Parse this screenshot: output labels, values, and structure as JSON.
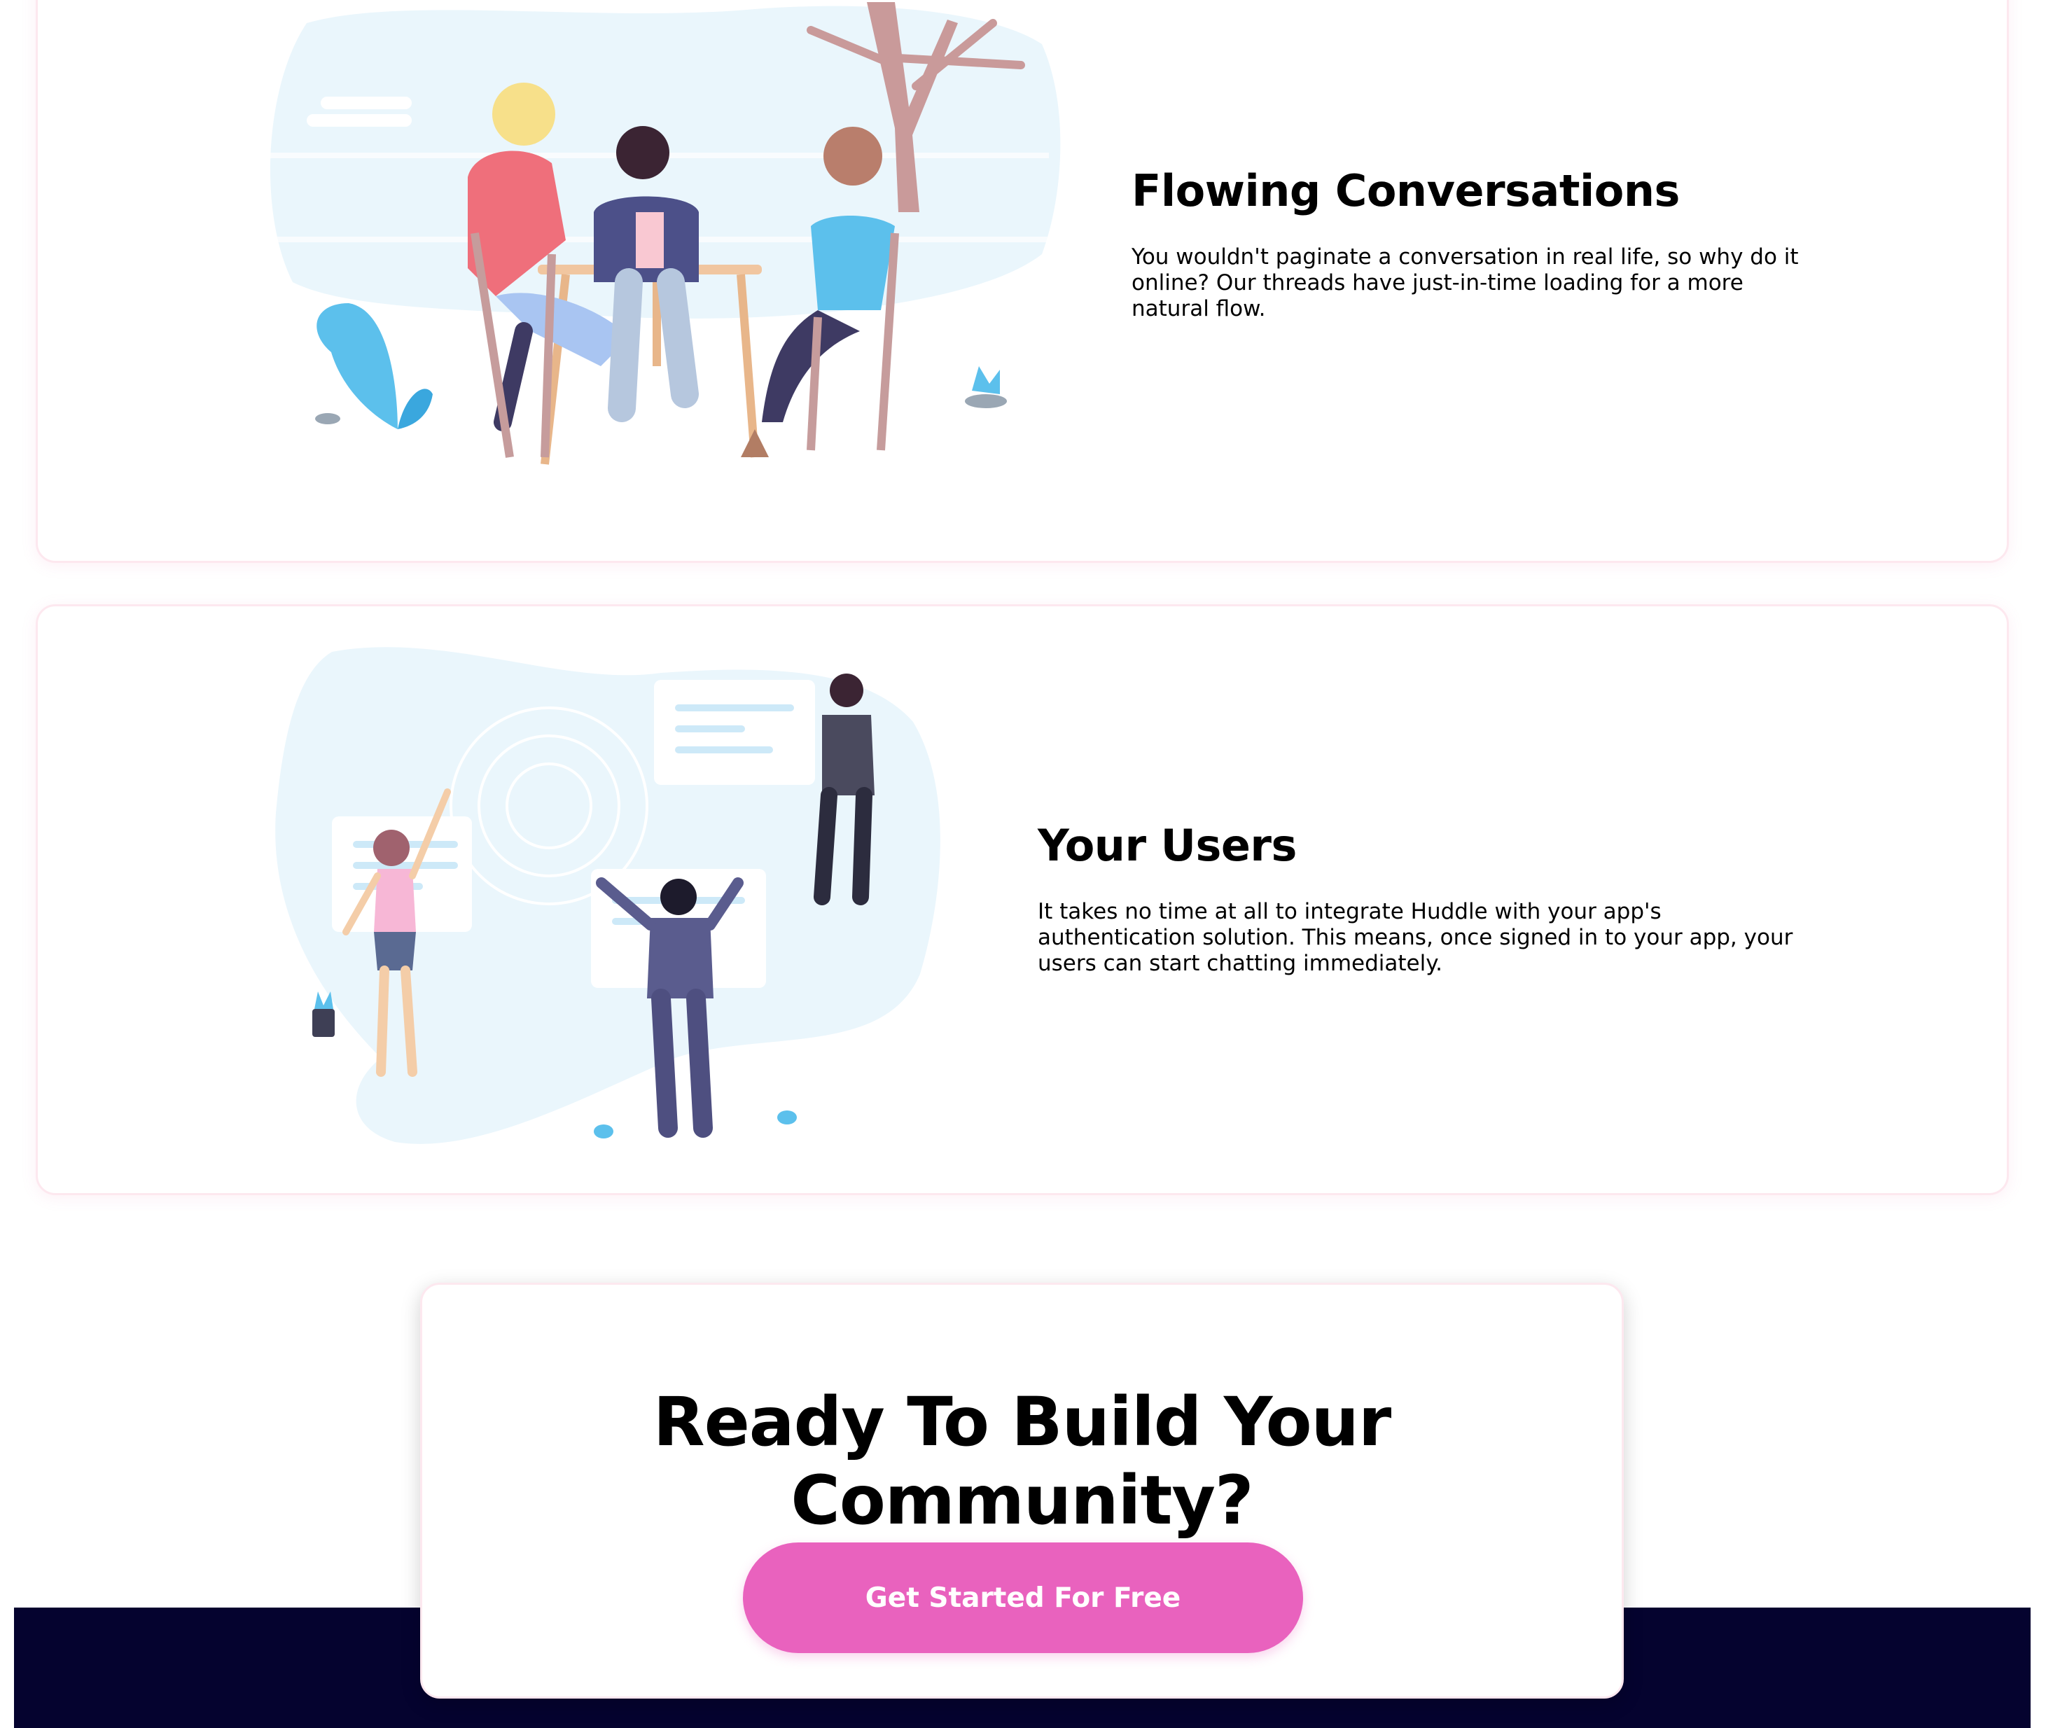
{
  "features": [
    {
      "title": "Flowing Conversations",
      "body": "You wouldn't paginate a conversation in real life, so why do it online? Our threads have just-in-time loading for a more natural flow.",
      "illustration_icon": "people-at-table-illustration"
    },
    {
      "title": "Your Users",
      "body": "It takes no time at all to integrate Huddle with your app's authentication solution. This means, once signed in to your app, your users can start chatting immediately.",
      "illustration_icon": "people-with-chat-bubbles-illustration"
    }
  ],
  "cta": {
    "title": "Ready To Build Your Community?",
    "button_label": "Get Started For Free"
  },
  "colors": {
    "accent": "#e962be",
    "footer_bg": "#05032f",
    "card_border": "#fde8ef",
    "illustration_blob": "#e6f4fb"
  }
}
